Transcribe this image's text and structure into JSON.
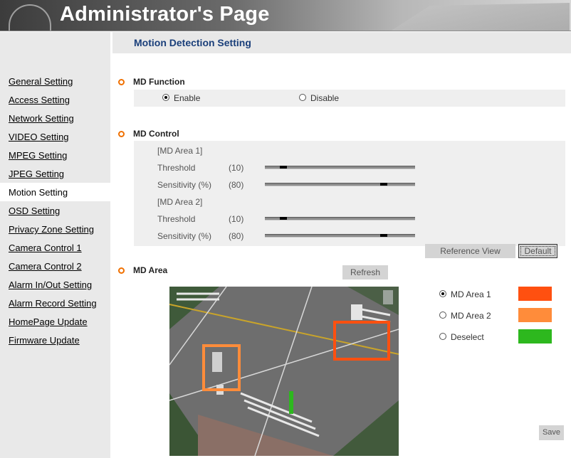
{
  "header": {
    "title": "Administrator's Page"
  },
  "page_title": "Motion Detection Setting",
  "sidebar": {
    "items": [
      {
        "label": "General Setting"
      },
      {
        "label": "Access Setting"
      },
      {
        "label": "Network Setting"
      },
      {
        "label": "VIDEO Setting"
      },
      {
        "label": "MPEG Setting"
      },
      {
        "label": "JPEG Setting"
      },
      {
        "label": "Motion Setting",
        "active": true
      },
      {
        "label": "OSD Setting"
      },
      {
        "label": "Privacy Zone Setting"
      },
      {
        "label": "Camera Control 1"
      },
      {
        "label": "Camera Control 2"
      },
      {
        "label": "Alarm In/Out Setting"
      },
      {
        "label": "Alarm Record Setting"
      },
      {
        "label": "HomePage Update"
      },
      {
        "label": "Firmware Update"
      }
    ]
  },
  "md_function": {
    "title": "MD Function",
    "enable": "Enable",
    "disable": "Disable",
    "selected": "enable"
  },
  "md_control": {
    "title": "MD Control",
    "area1": {
      "header": "[MD Area 1]",
      "threshold_label": "Threshold",
      "threshold_value": "(10)",
      "sensitivity_label": "Sensitivity (%)",
      "sensitivity_value": "(80)",
      "threshold_level": 10,
      "sensitivity_level": 80
    },
    "area2": {
      "header": "[MD Area 2]",
      "threshold_label": "Threshold",
      "threshold_value": "(10)",
      "sensitivity_label": "Sensitivity (%)",
      "sensitivity_value": "(80)",
      "threshold_level": 10,
      "sensitivity_level": 80
    },
    "reference_view": "Reference View",
    "default": "Default"
  },
  "md_area": {
    "title": "MD Area",
    "refresh": "Refresh",
    "options": [
      {
        "label": "MD Area 1",
        "color": "#ff5010",
        "selected": true
      },
      {
        "label": "MD Area 2",
        "color": "#ff8c3a",
        "selected": false
      },
      {
        "label": "Deselect",
        "color": "#2db81e",
        "selected": false
      }
    ],
    "save": "Save"
  }
}
